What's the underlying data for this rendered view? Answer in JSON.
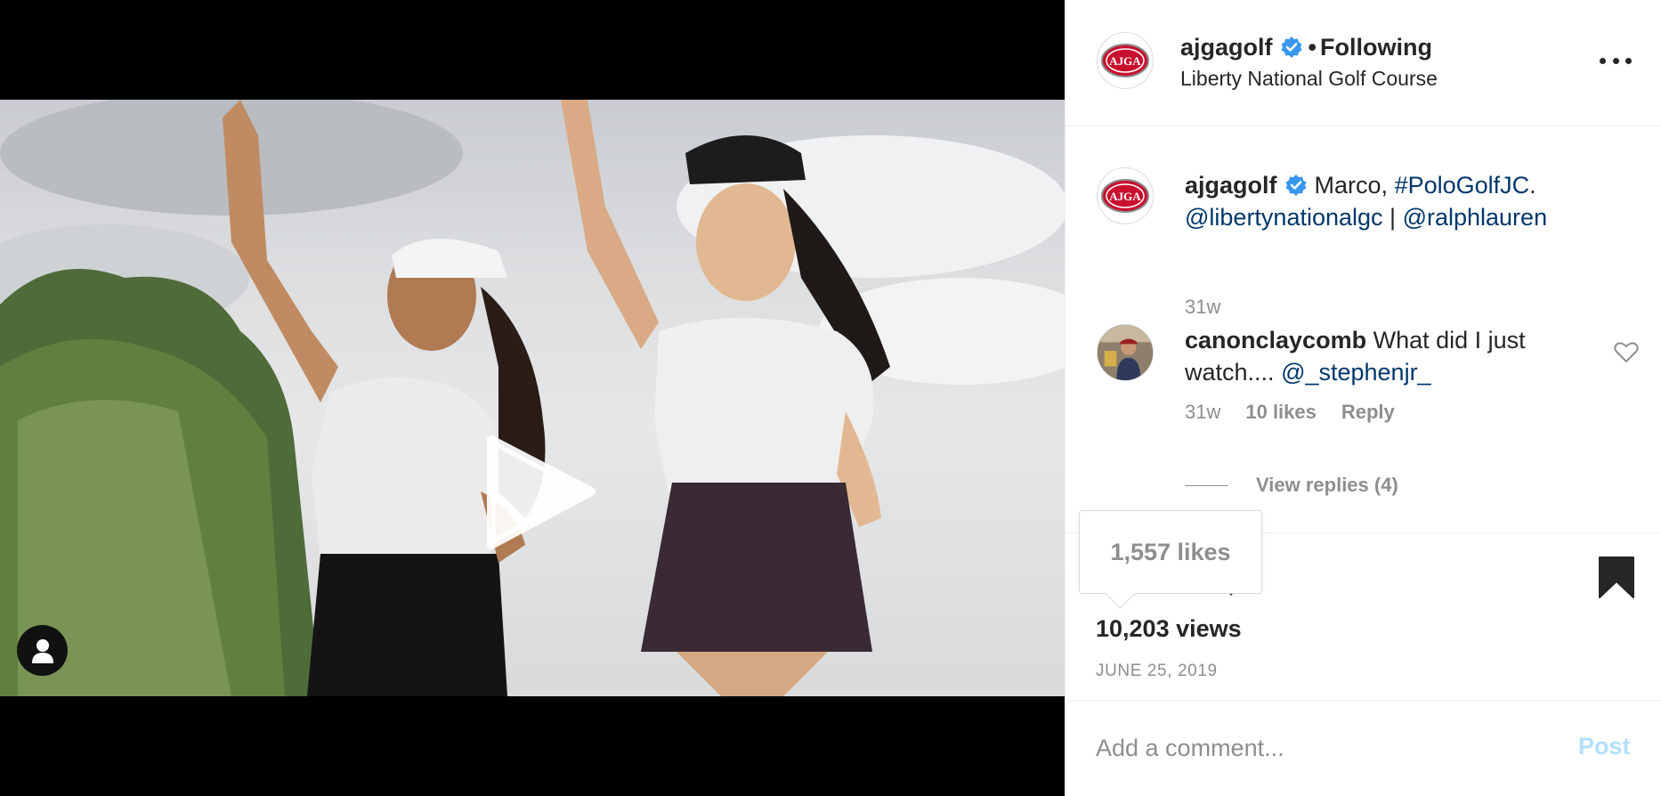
{
  "header": {
    "username": "ajgagolf",
    "separator": "•",
    "follow_status": "Following",
    "location": "Liberty National Golf Course",
    "avatar_text": "AJGA"
  },
  "caption": {
    "username": "ajgagolf",
    "text": "Marco,",
    "hashtag": "#PoloGolfJC",
    "after_hashtag": ".",
    "mention_1": "@libertynationalgc",
    "divider": "|",
    "mention_2": "@ralphlauren",
    "time": "31w"
  },
  "comment": {
    "username": "canonclaycomb",
    "text": "What did I just watch....",
    "mention": "@_stephenjr_",
    "time": "31w",
    "likes": "10 likes",
    "reply_label": "Reply",
    "view_replies": "View replies (4)"
  },
  "stats": {
    "likes_tooltip": "1,557 likes",
    "views": "10,203 views",
    "date": "JUNE 25, 2019"
  },
  "add_comment": {
    "placeholder": "Add a comment...",
    "post_label": "Post"
  },
  "colors": {
    "link": "#00376b",
    "verified": "#3897f0",
    "muted": "#8e8e8e",
    "post_disabled": "#b2dffc"
  },
  "icons": [
    "play-icon",
    "user-tag-icon",
    "verified-icon",
    "more-icon",
    "heart-icon",
    "comment-icon",
    "share-icon",
    "bookmark-icon"
  ]
}
